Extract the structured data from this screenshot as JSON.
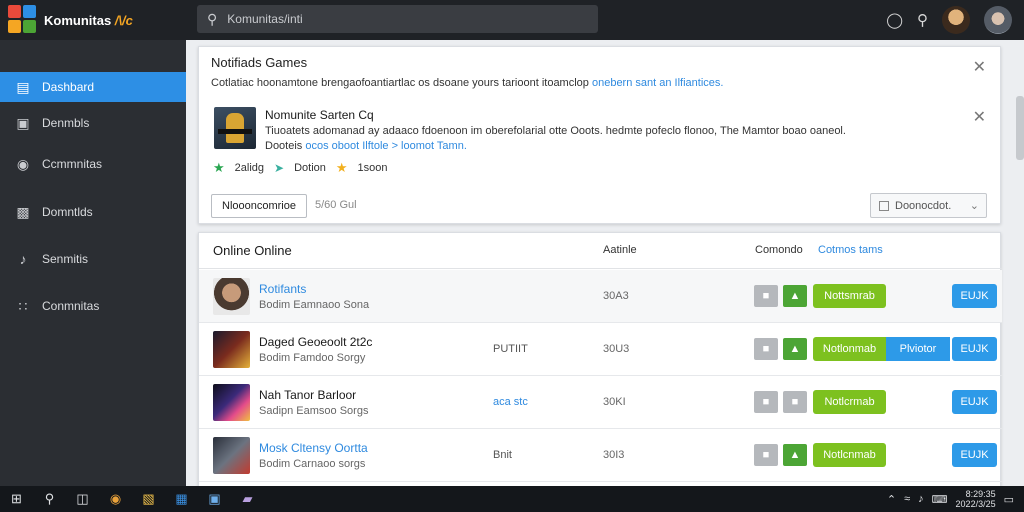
{
  "app": {
    "title": "Komunitas",
    "title_accent": "/\\/c"
  },
  "search": {
    "placeholder": "Komunitas/inti"
  },
  "sidebar": {
    "items": [
      {
        "label": "Dashbard",
        "icon": "chart-icon",
        "active": true
      },
      {
        "label": "Denmbls",
        "icon": "inbox-icon",
        "active": false
      },
      {
        "label": "Ccmmnitas",
        "icon": "chat-icon",
        "active": false
      },
      {
        "label": "Domntlds",
        "icon": "download-icon",
        "active": false
      },
      {
        "label": "Senmitis",
        "icon": "music-icon",
        "active": false
      },
      {
        "label": "Conmnitas",
        "icon": "grid-icon",
        "active": false
      }
    ]
  },
  "notification": {
    "title": "Notifiads Games",
    "subtitle": "Cotlatiac hoonamtone brengaofoantiartlac os dsoane yours tarioont itoamclop",
    "subtitle_link": "onebern sant an Ilfiantices.",
    "game_title": "Nomunite Sarten Cq",
    "desc": "Tiuoatets adomanad ay adaaco fdoenoon im oberefolarial otte Ooots. hedmte pofeclo flonoo, The Mamtor boao oaneol.",
    "desc2_prefix": "Dooteis",
    "desc2_link": "ocos oboot Ilftole > loomot Tamn.",
    "badge1": "2alidg",
    "badge2": "Dotion",
    "badge3": "1soon",
    "button": "Nloooncomrioe",
    "muted": "5/60 Gul",
    "dropdown": "Doonocdot."
  },
  "online": {
    "title": "Online Online",
    "col_activity": "Aatinle",
    "col_comm": "Comondo",
    "col_link": "Cotmos tams",
    "rows": [
      {
        "name": "Rotifants",
        "sub": "Bodim Eamnaoo Sona",
        "mid": "",
        "num": "30A3",
        "green_btn": "Nottsmrab",
        "blue_mid": "",
        "blue_btn": "EUJK",
        "thumb": "portrait"
      },
      {
        "name": "Daged Geoeoolt 2t2c",
        "sub": "Bodim Famdoo Sorgy",
        "mid": "PUTIIT",
        "num": "30U3",
        "green_btn": "Notlonmab",
        "blue_mid": "Plviotor",
        "blue_btn": "EUJK",
        "thumb": "game1"
      },
      {
        "name": "Nah Tanor Barloor",
        "sub": "Sadipn Eamsoo Sorgs",
        "mid": "aca stc",
        "num": "30KI",
        "green_btn": "Notlcrmab",
        "blue_mid": "",
        "blue_btn": "EUJK",
        "thumb": "game2"
      },
      {
        "name": "Mosk Cltensy Oortta",
        "sub": "Bodim Carnaoo sorgs",
        "mid": "Bnit",
        "num": "30I3",
        "green_btn": "Notlcnmab",
        "blue_mid": "",
        "blue_btn": "EUJK",
        "thumb": "game3"
      }
    ]
  },
  "taskbar": {
    "clock_time": "8:29:35",
    "clock_date": "2022/3/25"
  },
  "colors": {
    "accent": "#2d8fe5",
    "green": "#7dc11f",
    "sidebar": "#2b2e33",
    "topbar": "#1f2226"
  }
}
